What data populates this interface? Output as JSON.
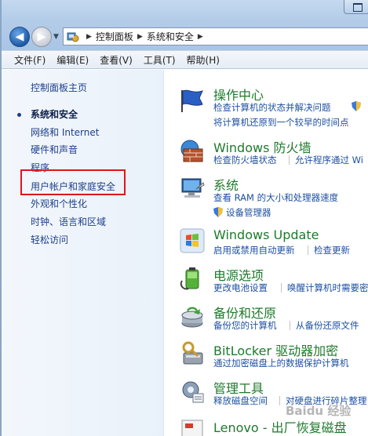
{
  "address": {
    "crumbs": [
      "控制面板",
      "系统和安全"
    ]
  },
  "menu": [
    "文件(F)",
    "编辑(E)",
    "查看(V)",
    "工具(T)",
    "帮助(H)"
  ],
  "leftnav": {
    "items": [
      "控制面板主页",
      "系统和安全",
      "网络和 Internet",
      "硬件和声音",
      "程序",
      "用户帐户和家庭安全",
      "外观和个性化",
      "时钟、语言和区域",
      "轻松访问"
    ],
    "current": "系统和安全",
    "highlighted": "用户帐户和家庭安全"
  },
  "categories": [
    {
      "title": "操作中心",
      "links": [
        "检查计算机的状态并解决问题",
        "将计算机还原到一个较早的时间点"
      ]
    },
    {
      "title": "Windows 防火墙",
      "links": [
        "检查防火墙状态",
        "允许程序通过 Wi"
      ]
    },
    {
      "title": "系统",
      "links": [
        "查看 RAM 的大小和处理器速度",
        "设备管理器"
      ]
    },
    {
      "title": "Windows Update",
      "links": [
        "启用或禁用自动更新",
        "检查更新"
      ]
    },
    {
      "title": "电源选项",
      "links": [
        "更改电池设置",
        "唤醒计算机时需要密码"
      ]
    },
    {
      "title": "备份和还原",
      "links": [
        "备份您的计算机",
        "从备份还原文件"
      ]
    },
    {
      "title": "BitLocker 驱动器加密",
      "links": [
        "通过加密磁盘上的数据保护计算机"
      ]
    },
    {
      "title": "管理工具",
      "links": [
        "释放磁盘空间",
        "对硬盘进行碎片整理"
      ]
    },
    {
      "title": "Lenovo - 出厂恢复磁盘",
      "links": []
    }
  ],
  "watermark": "Baidu 经验"
}
